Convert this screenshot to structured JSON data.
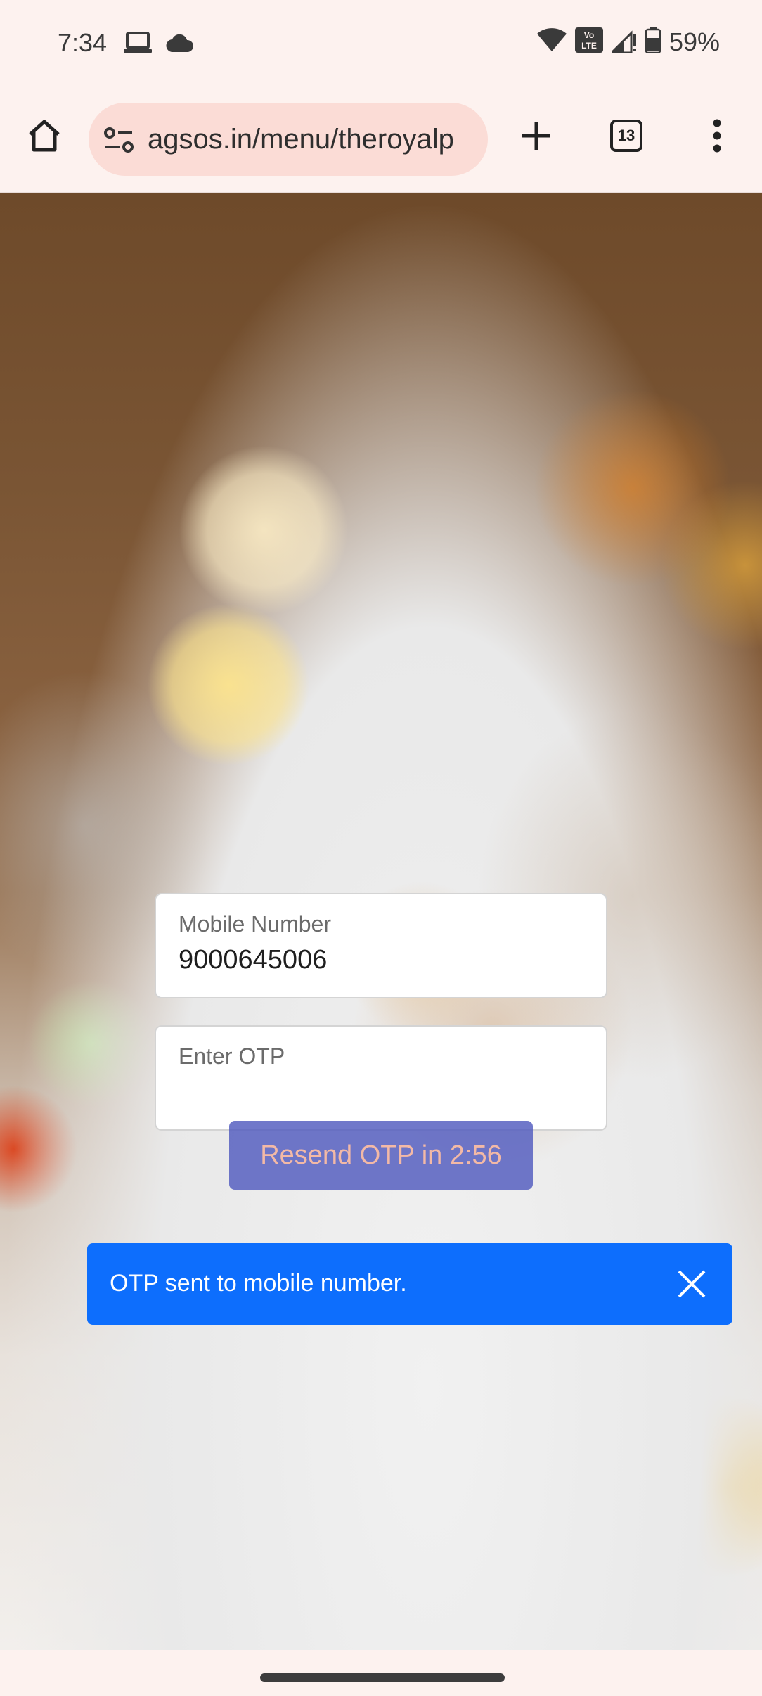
{
  "status_bar": {
    "time": "7:34",
    "left_icons": [
      "laptop-icon",
      "cloud-icon"
    ],
    "right_icons": [
      "wifi-icon",
      "volte-icon",
      "signal-icon",
      "battery-icon"
    ],
    "volte_label": "Vo LTE",
    "battery_percent": "59%"
  },
  "browser": {
    "url": "agsos.in/menu/theroyalp",
    "tab_count": "13",
    "icons": {
      "home": "home-icon",
      "site_info": "tune-icon",
      "new_tab": "plus-icon",
      "menu": "more-vert-icon"
    }
  },
  "form": {
    "mobile": {
      "label": "Mobile Number",
      "value": "9000645006"
    },
    "otp": {
      "label": "Enter OTP",
      "value": ""
    },
    "resend_label": "Resend OTP in 2:56"
  },
  "toast": {
    "message": "OTP sent to mobile number.",
    "close_icon": "close-icon",
    "color": "#0d6efd"
  },
  "colors": {
    "chrome_bg": "#fdf2ef",
    "url_pill": "#fbdcd6",
    "resend_button": "#505abe",
    "resend_text": "#f3b9a6"
  }
}
